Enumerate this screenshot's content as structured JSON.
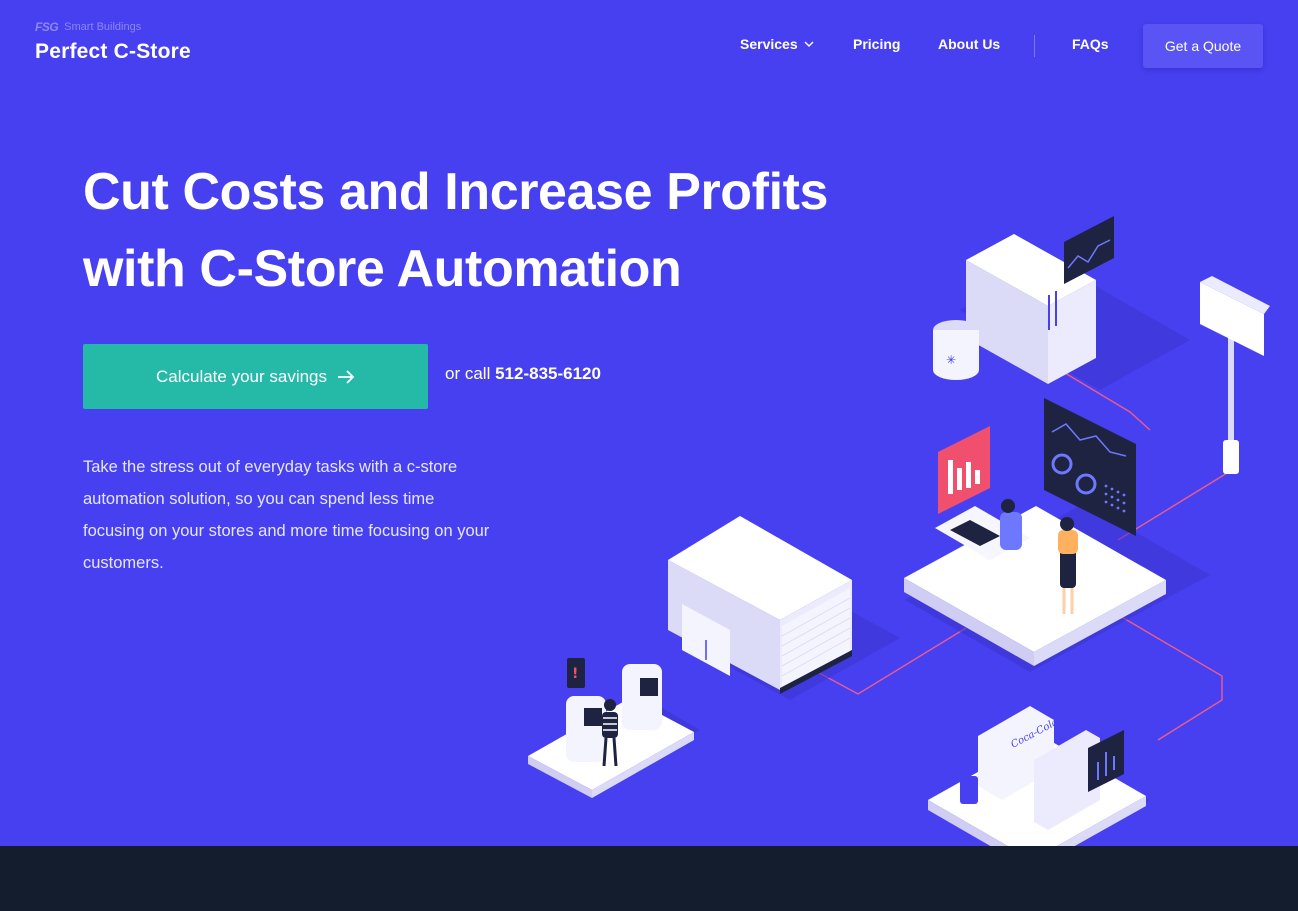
{
  "brand": {
    "mark": "FSG",
    "tagline": "Smart Buildings",
    "name": "Perfect C-Store"
  },
  "nav": {
    "items": [
      {
        "label": "Services",
        "has_dropdown": true,
        "icon": "chevron-down-icon"
      },
      {
        "label": "Pricing"
      },
      {
        "label": "About Us"
      },
      {
        "label": "FAQs"
      }
    ],
    "cta_label": "Get a Quote"
  },
  "hero": {
    "headline_line1": "Cut Costs and Increase Profits",
    "headline_line2": "with C-Store Automation",
    "cta_label": "Calculate your savings",
    "cta_icon": "arrow-right-icon",
    "call_prefix": "or call",
    "phone": "512-835-6120",
    "description": "Take the stress out of everyday tasks with a c-store automation solution, so you can spend less time focusing on your stores and more time focusing on your customers."
  },
  "illustration": {
    "cooler_label": "Coca-Cola"
  },
  "colors": {
    "hero_bg": "#4740f1",
    "cta_bg": "#25b9a8",
    "quote_btn_bg": "#5a54f5",
    "footer_bg": "#141d2e",
    "accent_red": "#f0506e"
  }
}
